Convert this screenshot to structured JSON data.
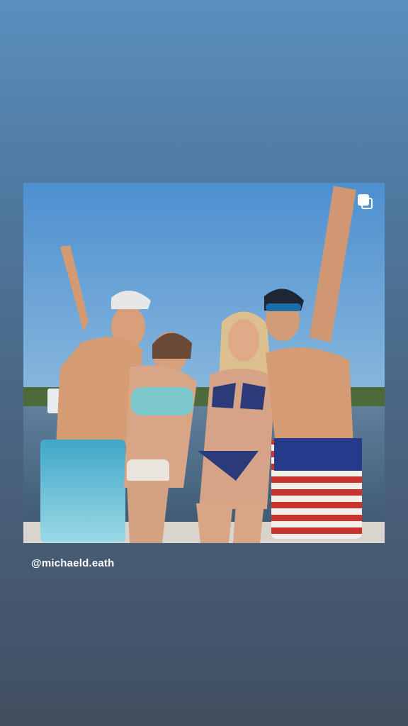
{
  "story": {
    "mention": "@michaeld.eath",
    "post_icon": "multiple-photos-icon",
    "colors": {
      "background_top": "#5b8fbd",
      "background_bottom": "#424e60",
      "text": "#ffffff"
    }
  }
}
